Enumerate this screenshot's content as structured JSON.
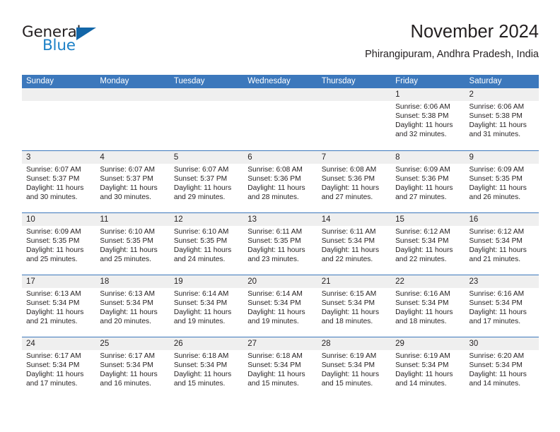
{
  "brand": {
    "name_top": "General",
    "name_bottom": "Blue",
    "triangle_color": "#1266a8",
    "blue_text_color": "#1d81c7"
  },
  "header": {
    "title": "November 2024",
    "subtitle": "Phirangipuram, Andhra Pradesh, India"
  },
  "theme": {
    "header_blue": "#3c78bc",
    "daynum_gray": "#efefef",
    "text": "#231f20"
  },
  "weekdays": [
    "Sunday",
    "Monday",
    "Tuesday",
    "Wednesday",
    "Thursday",
    "Friday",
    "Saturday"
  ],
  "weeks": [
    [
      {
        "day": "",
        "empty": true
      },
      {
        "day": "",
        "empty": true
      },
      {
        "day": "",
        "empty": true
      },
      {
        "day": "",
        "empty": true
      },
      {
        "day": "",
        "empty": true
      },
      {
        "day": "1",
        "sunrise": "Sunrise: 6:06 AM",
        "sunset": "Sunset: 5:38 PM",
        "daylight1": "Daylight: 11 hours",
        "daylight2": "and 32 minutes."
      },
      {
        "day": "2",
        "sunrise": "Sunrise: 6:06 AM",
        "sunset": "Sunset: 5:38 PM",
        "daylight1": "Daylight: 11 hours",
        "daylight2": "and 31 minutes."
      }
    ],
    [
      {
        "day": "3",
        "sunrise": "Sunrise: 6:07 AM",
        "sunset": "Sunset: 5:37 PM",
        "daylight1": "Daylight: 11 hours",
        "daylight2": "and 30 minutes."
      },
      {
        "day": "4",
        "sunrise": "Sunrise: 6:07 AM",
        "sunset": "Sunset: 5:37 PM",
        "daylight1": "Daylight: 11 hours",
        "daylight2": "and 30 minutes."
      },
      {
        "day": "5",
        "sunrise": "Sunrise: 6:07 AM",
        "sunset": "Sunset: 5:37 PM",
        "daylight1": "Daylight: 11 hours",
        "daylight2": "and 29 minutes."
      },
      {
        "day": "6",
        "sunrise": "Sunrise: 6:08 AM",
        "sunset": "Sunset: 5:36 PM",
        "daylight1": "Daylight: 11 hours",
        "daylight2": "and 28 minutes."
      },
      {
        "day": "7",
        "sunrise": "Sunrise: 6:08 AM",
        "sunset": "Sunset: 5:36 PM",
        "daylight1": "Daylight: 11 hours",
        "daylight2": "and 27 minutes."
      },
      {
        "day": "8",
        "sunrise": "Sunrise: 6:09 AM",
        "sunset": "Sunset: 5:36 PM",
        "daylight1": "Daylight: 11 hours",
        "daylight2": "and 27 minutes."
      },
      {
        "day": "9",
        "sunrise": "Sunrise: 6:09 AM",
        "sunset": "Sunset: 5:35 PM",
        "daylight1": "Daylight: 11 hours",
        "daylight2": "and 26 minutes."
      }
    ],
    [
      {
        "day": "10",
        "sunrise": "Sunrise: 6:09 AM",
        "sunset": "Sunset: 5:35 PM",
        "daylight1": "Daylight: 11 hours",
        "daylight2": "and 25 minutes."
      },
      {
        "day": "11",
        "sunrise": "Sunrise: 6:10 AM",
        "sunset": "Sunset: 5:35 PM",
        "daylight1": "Daylight: 11 hours",
        "daylight2": "and 25 minutes."
      },
      {
        "day": "12",
        "sunrise": "Sunrise: 6:10 AM",
        "sunset": "Sunset: 5:35 PM",
        "daylight1": "Daylight: 11 hours",
        "daylight2": "and 24 minutes."
      },
      {
        "day": "13",
        "sunrise": "Sunrise: 6:11 AM",
        "sunset": "Sunset: 5:35 PM",
        "daylight1": "Daylight: 11 hours",
        "daylight2": "and 23 minutes."
      },
      {
        "day": "14",
        "sunrise": "Sunrise: 6:11 AM",
        "sunset": "Sunset: 5:34 PM",
        "daylight1": "Daylight: 11 hours",
        "daylight2": "and 22 minutes."
      },
      {
        "day": "15",
        "sunrise": "Sunrise: 6:12 AM",
        "sunset": "Sunset: 5:34 PM",
        "daylight1": "Daylight: 11 hours",
        "daylight2": "and 22 minutes."
      },
      {
        "day": "16",
        "sunrise": "Sunrise: 6:12 AM",
        "sunset": "Sunset: 5:34 PM",
        "daylight1": "Daylight: 11 hours",
        "daylight2": "and 21 minutes."
      }
    ],
    [
      {
        "day": "17",
        "sunrise": "Sunrise: 6:13 AM",
        "sunset": "Sunset: 5:34 PM",
        "daylight1": "Daylight: 11 hours",
        "daylight2": "and 21 minutes."
      },
      {
        "day": "18",
        "sunrise": "Sunrise: 6:13 AM",
        "sunset": "Sunset: 5:34 PM",
        "daylight1": "Daylight: 11 hours",
        "daylight2": "and 20 minutes."
      },
      {
        "day": "19",
        "sunrise": "Sunrise: 6:14 AM",
        "sunset": "Sunset: 5:34 PM",
        "daylight1": "Daylight: 11 hours",
        "daylight2": "and 19 minutes."
      },
      {
        "day": "20",
        "sunrise": "Sunrise: 6:14 AM",
        "sunset": "Sunset: 5:34 PM",
        "daylight1": "Daylight: 11 hours",
        "daylight2": "and 19 minutes."
      },
      {
        "day": "21",
        "sunrise": "Sunrise: 6:15 AM",
        "sunset": "Sunset: 5:34 PM",
        "daylight1": "Daylight: 11 hours",
        "daylight2": "and 18 minutes."
      },
      {
        "day": "22",
        "sunrise": "Sunrise: 6:16 AM",
        "sunset": "Sunset: 5:34 PM",
        "daylight1": "Daylight: 11 hours",
        "daylight2": "and 18 minutes."
      },
      {
        "day": "23",
        "sunrise": "Sunrise: 6:16 AM",
        "sunset": "Sunset: 5:34 PM",
        "daylight1": "Daylight: 11 hours",
        "daylight2": "and 17 minutes."
      }
    ],
    [
      {
        "day": "24",
        "sunrise": "Sunrise: 6:17 AM",
        "sunset": "Sunset: 5:34 PM",
        "daylight1": "Daylight: 11 hours",
        "daylight2": "and 17 minutes."
      },
      {
        "day": "25",
        "sunrise": "Sunrise: 6:17 AM",
        "sunset": "Sunset: 5:34 PM",
        "daylight1": "Daylight: 11 hours",
        "daylight2": "and 16 minutes."
      },
      {
        "day": "26",
        "sunrise": "Sunrise: 6:18 AM",
        "sunset": "Sunset: 5:34 PM",
        "daylight1": "Daylight: 11 hours",
        "daylight2": "and 15 minutes."
      },
      {
        "day": "27",
        "sunrise": "Sunrise: 6:18 AM",
        "sunset": "Sunset: 5:34 PM",
        "daylight1": "Daylight: 11 hours",
        "daylight2": "and 15 minutes."
      },
      {
        "day": "28",
        "sunrise": "Sunrise: 6:19 AM",
        "sunset": "Sunset: 5:34 PM",
        "daylight1": "Daylight: 11 hours",
        "daylight2": "and 15 minutes."
      },
      {
        "day": "29",
        "sunrise": "Sunrise: 6:19 AM",
        "sunset": "Sunset: 5:34 PM",
        "daylight1": "Daylight: 11 hours",
        "daylight2": "and 14 minutes."
      },
      {
        "day": "30",
        "sunrise": "Sunrise: 6:20 AM",
        "sunset": "Sunset: 5:34 PM",
        "daylight1": "Daylight: 11 hours",
        "daylight2": "and 14 minutes."
      }
    ]
  ]
}
